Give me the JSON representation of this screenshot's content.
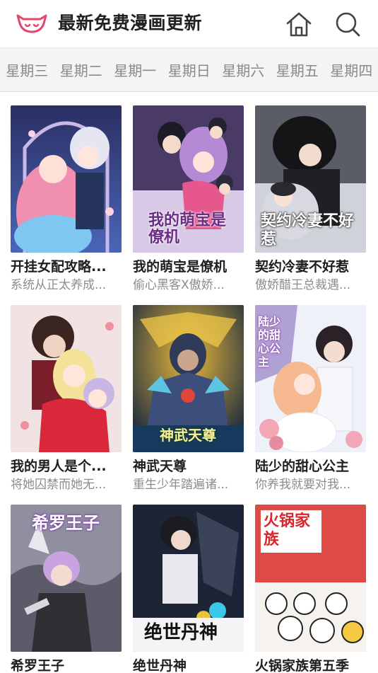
{
  "header": {
    "title": "最新免费漫画更新",
    "logo_icon": "cat-face-logo",
    "home_icon": "home-icon",
    "search_icon": "search-icon",
    "accent_color": "#e8456b"
  },
  "tabs": [
    "星期三",
    "星期二",
    "星期一",
    "星期日",
    "星期六",
    "星期五",
    "星期四"
  ],
  "comics": [
    {
      "title": "开挂女配攻略...",
      "desc": "系统从正太养成...",
      "cover_text": ""
    },
    {
      "title": "我的萌宝是僚机",
      "desc": "偷心黑客X傲娇...",
      "cover_text": "我的萌宝是僚机"
    },
    {
      "title": "契约冷妻不好惹",
      "desc": "傲娇醋王总裁遇...",
      "cover_text": "契约冷妻不好惹"
    },
    {
      "title": "我的男人是个...",
      "desc": "将她囚禁而她无...",
      "cover_text": ""
    },
    {
      "title": "神武天尊",
      "desc": "重生少年踏遍诸...",
      "cover_text": "神武天尊"
    },
    {
      "title": "陆少的甜心公主",
      "desc": "你养我就要对我...",
      "cover_text": "陆少的甜心公主"
    },
    {
      "title": "希罗王子",
      "desc": "",
      "cover_text": "希罗王子"
    },
    {
      "title": "绝世丹神",
      "desc": "",
      "cover_text": "绝世丹神"
    },
    {
      "title": "火锅家族第五季",
      "desc": "",
      "cover_text": "火锅家族"
    }
  ]
}
